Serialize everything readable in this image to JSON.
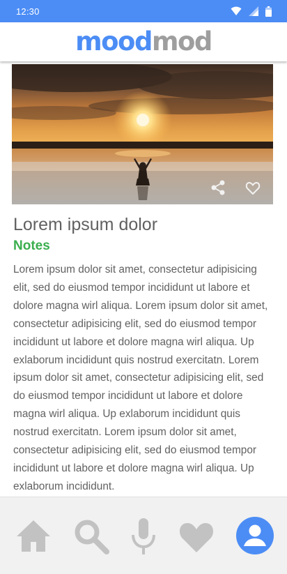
{
  "status_bar": {
    "time": "12:30",
    "icons": [
      "wifi-icon",
      "cellular-signal-icon",
      "battery-icon"
    ],
    "background": "#4c8df5"
  },
  "app_bar": {
    "logo_part1": "mood",
    "logo_part2": "mod",
    "logo_color1": "#4c8df5",
    "logo_color2": "#9e9e9e"
  },
  "card": {
    "image": "sunset-beach-meditation-photo",
    "actions": [
      "share-icon",
      "heart-outline-icon"
    ]
  },
  "article": {
    "title": "Lorem ipsum dolor",
    "subtitle": "Notes",
    "subtitle_color": "#3bae4e",
    "body": "Lorem ipsum dolor sit amet, consectetur adipisicing elit, sed do eiusmod tempor incididunt ut labore et dolore magna wirl aliqua. Lorem ipsum dolor sit amet, consectetur adipisicing elit, sed do eiusmod tempor incididunt ut labore et dolore magna wirl aliqua. Up exlaborum incididunt quis nostrud exercitatn. Lorem ipsum dolor sit amet, consectetur adipisicing elit, sed do eiusmod tempor incididunt ut labore et dolore magna wirl aliqua. Up exlaborum incididunt quis nostrud exercitatn. Lorem ipsum dolor sit amet, consectetur adipisicing elit, sed do eiusmod tempor incididunt ut labore et dolore magna wirl aliqua. Up exlaborum incididunt."
  },
  "bottom_nav": {
    "items": [
      {
        "icon": "home-icon",
        "active": false
      },
      {
        "icon": "search-icon",
        "active": false
      },
      {
        "icon": "microphone-icon",
        "active": false
      },
      {
        "icon": "heart-icon",
        "active": false
      },
      {
        "icon": "profile-icon",
        "active": true
      }
    ],
    "inactive_color": "#c2c2c2",
    "active_color": "#4c8df5"
  }
}
